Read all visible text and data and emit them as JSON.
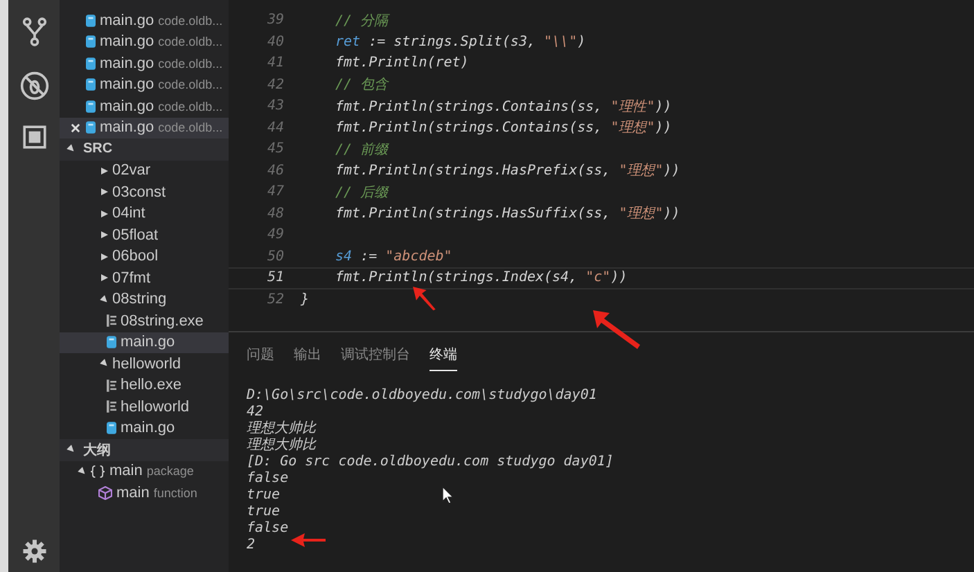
{
  "open_editors": [
    {
      "name": "main.go",
      "path": "code.oldb...",
      "selected": false
    },
    {
      "name": "main.go",
      "path": "code.oldb...",
      "selected": false
    },
    {
      "name": "main.go",
      "path": "code.oldb...",
      "selected": false
    },
    {
      "name": "main.go",
      "path": "code.oldb...",
      "selected": false
    },
    {
      "name": "main.go",
      "path": "code.oldb...",
      "selected": false
    },
    {
      "name": "main.go",
      "path": "code.oldb...",
      "selected": true
    }
  ],
  "src": {
    "label": "SRC",
    "expanded": true,
    "children": [
      {
        "kind": "folder",
        "label": "02var",
        "expanded": false
      },
      {
        "kind": "folder",
        "label": "03const",
        "expanded": false
      },
      {
        "kind": "folder",
        "label": "04int",
        "expanded": false
      },
      {
        "kind": "folder",
        "label": "05float",
        "expanded": false
      },
      {
        "kind": "folder",
        "label": "06bool",
        "expanded": false
      },
      {
        "kind": "folder",
        "label": "07fmt",
        "expanded": false
      },
      {
        "kind": "folder",
        "label": "08string",
        "expanded": true,
        "children": [
          {
            "kind": "file",
            "label": "08string.exe",
            "selected": false
          },
          {
            "kind": "go",
            "label": "main.go",
            "selected": true
          }
        ]
      },
      {
        "kind": "folder",
        "label": "helloworld",
        "expanded": true,
        "children": [
          {
            "kind": "file",
            "label": "hello.exe",
            "selected": false
          },
          {
            "kind": "file",
            "label": "helloworld",
            "selected": false
          },
          {
            "kind": "go",
            "label": "main.go",
            "selected": false
          }
        ]
      }
    ]
  },
  "outline": {
    "label": "大纲",
    "expanded": true,
    "children": [
      {
        "kind": "package",
        "label": "main",
        "detail": "package",
        "expanded": true,
        "children": [
          {
            "kind": "function",
            "label": "main",
            "detail": "function"
          }
        ]
      }
    ]
  },
  "editor": {
    "lines": [
      {
        "number": "39",
        "current": false,
        "tokens": [
          {
            "kind": "comment",
            "t": "// 分隔"
          }
        ]
      },
      {
        "number": "40",
        "current": false,
        "tokens": [
          {
            "kind": "var",
            "t": "ret"
          },
          {
            "kind": "plain",
            "t": " := strings.Split(s3, "
          },
          {
            "kind": "string",
            "t": "\"\\\\\""
          },
          {
            "kind": "plain",
            "t": ")"
          }
        ]
      },
      {
        "number": "41",
        "current": false,
        "tokens": [
          {
            "kind": "plain",
            "t": "fmt.Println(ret)"
          }
        ]
      },
      {
        "number": "42",
        "current": false,
        "tokens": [
          {
            "kind": "comment",
            "t": "// 包含"
          }
        ]
      },
      {
        "number": "43",
        "current": false,
        "tokens": [
          {
            "kind": "plain",
            "t": "fmt.Println(strings.Contains(ss, "
          },
          {
            "kind": "string",
            "t": "\"理性\""
          },
          {
            "kind": "plain",
            "t": "))"
          }
        ]
      },
      {
        "number": "44",
        "current": false,
        "tokens": [
          {
            "kind": "plain",
            "t": "fmt.Println(strings.Contains(ss, "
          },
          {
            "kind": "string",
            "t": "\"理想\""
          },
          {
            "kind": "plain",
            "t": "))"
          }
        ]
      },
      {
        "number": "45",
        "current": false,
        "tokens": [
          {
            "kind": "comment",
            "t": "// 前缀"
          }
        ]
      },
      {
        "number": "46",
        "current": false,
        "tokens": [
          {
            "kind": "plain",
            "t": "fmt.Println(strings.HasPrefix(ss, "
          },
          {
            "kind": "string",
            "t": "\"理想\""
          },
          {
            "kind": "plain",
            "t": "))"
          }
        ]
      },
      {
        "number": "47",
        "current": false,
        "tokens": [
          {
            "kind": "comment",
            "t": "// 后缀"
          }
        ]
      },
      {
        "number": "48",
        "current": false,
        "tokens": [
          {
            "kind": "plain",
            "t": "fmt.Println(strings.HasSuffix(ss, "
          },
          {
            "kind": "string",
            "t": "\"理想\""
          },
          {
            "kind": "plain",
            "t": "))"
          }
        ]
      },
      {
        "number": "49",
        "current": false
      },
      {
        "number": "50",
        "current": false,
        "tokens": [
          {
            "kind": "var",
            "t": "s4"
          },
          {
            "kind": "plain",
            "t": " := "
          },
          {
            "kind": "string",
            "t": "\"abcdeb\""
          }
        ]
      },
      {
        "number": "51",
        "current": true,
        "tokens": [
          {
            "kind": "plain",
            "t": "fmt.Println(strings.Index(s4, "
          },
          {
            "kind": "string",
            "t": "\"c\""
          },
          {
            "kind": "plain",
            "t": "))"
          }
        ]
      },
      {
        "number": "52",
        "current": false,
        "tokens": [
          {
            "kind": "brace",
            "t": "}"
          }
        ]
      }
    ]
  },
  "panel": {
    "tabs": [
      {
        "label": "问题",
        "selected": false
      },
      {
        "label": "输出",
        "selected": false
      },
      {
        "label": "调试控制台",
        "selected": false
      },
      {
        "label": "终端",
        "selected": true
      }
    ],
    "terminal": [
      "D:\\Go\\src\\code.oldboyedu.com\\studygo\\day01",
      "42",
      "理想大帅比",
      "理想大帅比",
      "[D: Go src code.oldboyedu.com studygo day01]",
      "false",
      "true",
      "true",
      "false",
      "2"
    ]
  }
}
